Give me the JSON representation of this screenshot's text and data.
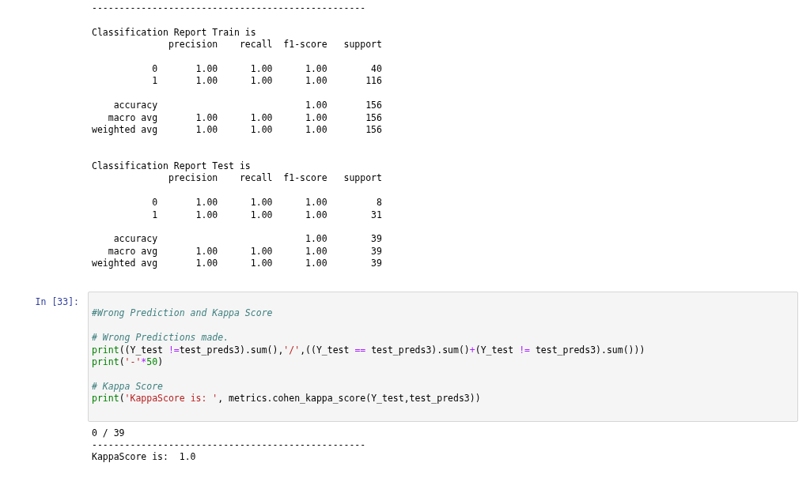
{
  "previous_output": {
    "lines": [
      "--------------------------------------------------"
    ]
  },
  "reports": [
    {
      "title": "Classification Report Train is",
      "header": "              precision    recall  f1-score   support",
      "class_rows": [
        "           0       1.00      1.00      1.00        40",
        "           1       1.00      1.00      1.00       116"
      ],
      "summary_rows": [
        "    accuracy                           1.00       156",
        "   macro avg       1.00      1.00      1.00       156",
        "weighted avg       1.00      1.00      1.00       156"
      ]
    },
    {
      "title": "Classification Report Test is",
      "header": "              precision    recall  f1-score   support",
      "class_rows": [
        "           0       1.00      1.00      1.00         8",
        "           1       1.00      1.00      1.00        31"
      ],
      "summary_rows": [
        "    accuracy                           1.00        39",
        "   macro avg       1.00      1.00      1.00        39",
        "weighted avg       1.00      1.00      1.00        39"
      ]
    }
  ],
  "cell": {
    "prompt": "In [33]:",
    "code_blocks": [
      [
        [
          {
            "kind": "comment",
            "text": "#Wrong Prediction and Kappa Score"
          }
        ]
      ],
      [
        [
          {
            "kind": "comment",
            "text": "# Wrong Predictions made."
          }
        ],
        [
          {
            "kind": "builtin",
            "text": "print"
          },
          {
            "kind": "plain",
            "text": "((Y_test "
          },
          {
            "kind": "op",
            "text": "!="
          },
          {
            "kind": "plain",
            "text": "test_preds3).sum(),"
          },
          {
            "kind": "string",
            "text": "'/'"
          },
          {
            "kind": "plain",
            "text": ",((Y_test "
          },
          {
            "kind": "op",
            "text": "=="
          },
          {
            "kind": "plain",
            "text": " test_preds3).sum()"
          },
          {
            "kind": "op",
            "text": "+"
          },
          {
            "kind": "plain",
            "text": "(Y_test "
          },
          {
            "kind": "op",
            "text": "!="
          },
          {
            "kind": "plain",
            "text": " test_preds3).sum()))"
          }
        ],
        [
          {
            "kind": "builtin",
            "text": "print"
          },
          {
            "kind": "plain",
            "text": "("
          },
          {
            "kind": "string",
            "text": "'-'"
          },
          {
            "kind": "op",
            "text": "*"
          },
          {
            "kind": "number",
            "text": "50"
          },
          {
            "kind": "plain",
            "text": ")"
          }
        ]
      ],
      [
        [
          {
            "kind": "comment",
            "text": "# Kappa Score"
          }
        ],
        [
          {
            "kind": "builtin",
            "text": "print"
          },
          {
            "kind": "plain",
            "text": "("
          },
          {
            "kind": "string",
            "text": "'KappaScore is: '"
          },
          {
            "kind": "plain",
            "text": ", metrics.cohen_kappa_score(Y_test,test_preds3))"
          }
        ]
      ]
    ],
    "output": {
      "lines": [
        "0 / 39",
        "--------------------------------------------------",
        "KappaScore is:  1.0"
      ]
    }
  }
}
